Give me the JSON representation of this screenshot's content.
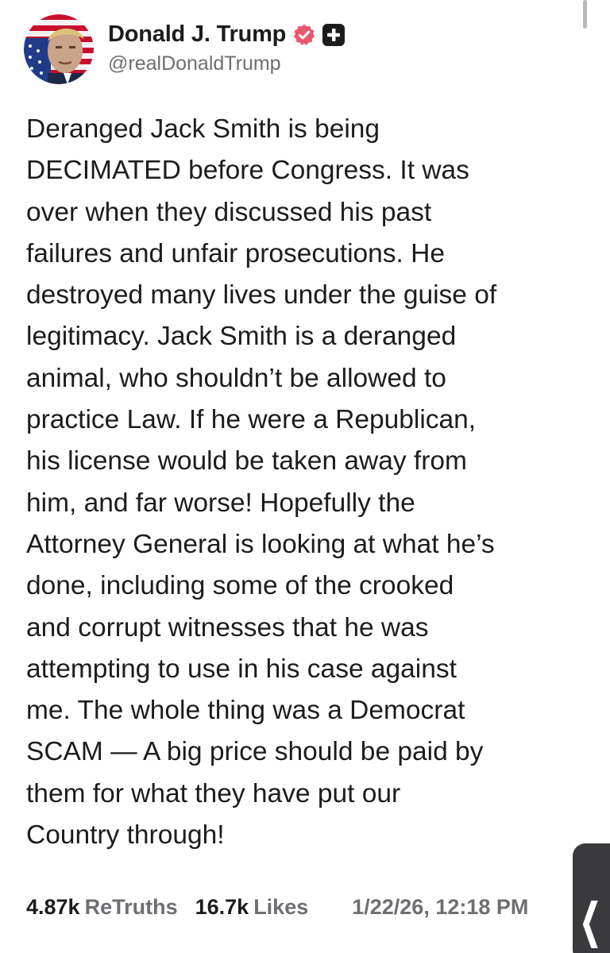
{
  "profile": {
    "display_name": "Donald J. Trump",
    "handle": "@realDonaldTrump",
    "verified_icon": "verified-badge-icon",
    "plus_icon": "plus-badge-icon",
    "avatar_icon": "avatar-portrait-flag"
  },
  "post": {
    "lines": [
      "Deranged Jack Smith is being",
      "DECIMATED before Congress. It was",
      "over when they discussed his past",
      "failures and unfair prosecutions. He",
      "destroyed many lives under the guise of",
      "legitimacy. Jack Smith is a deranged",
      "animal, who shouldn’t be allowed to",
      "practice Law. If he were a Republican,",
      "his license would be taken away from",
      "him, and far worse! Hopefully the",
      "Attorney General is looking at what he’s",
      "done, including some of the crooked",
      "and corrupt witnesses that he was",
      "attempting to use in his case against",
      "me. The whole thing was a Democrat",
      "SCAM — A big price should be paid by",
      "them for what they have put our",
      "Country through!"
    ]
  },
  "stats": {
    "retruths_count": "4.87k",
    "retruths_label": "ReTruths",
    "likes_count": "16.7k",
    "likes_label": "Likes",
    "timestamp": "1/22/26, 12:18 PM"
  },
  "controls": {
    "back_tab_glyph": "❮"
  },
  "colors": {
    "text_primary": "#1c1c1e",
    "text_secondary": "#6e6e73",
    "verified_pink": "#e8586b",
    "badge_dark": "#1c1c1e",
    "tab_dark": "#3a3a3c"
  }
}
